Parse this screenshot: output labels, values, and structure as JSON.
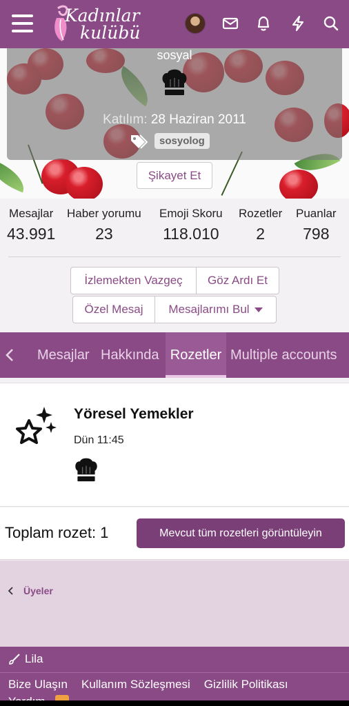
{
  "header": {
    "logo_line1": "Kadınlar",
    "logo_line2": "kulübü",
    "icons": [
      "menu-icon",
      "avatar",
      "envelope-icon",
      "bell-icon",
      "bolt-icon",
      "search-icon"
    ]
  },
  "cover": {
    "title": "sosyal",
    "joined_label": "Katılım:",
    "joined_date": "28 Haziran 2011",
    "tag": "sosyolog",
    "report_button": "Şikayet Et"
  },
  "stats": [
    {
      "label": "Mesajlar",
      "value": "43.991"
    },
    {
      "label": "Haber yorumu",
      "value": "23"
    },
    {
      "label": "Emoji Skoru",
      "value": "118.010"
    },
    {
      "label": "Rozetler",
      "value": "2"
    },
    {
      "label": "Puanlar",
      "value": "798"
    }
  ],
  "actions": {
    "unwatch": "İzlemekten Vazgeç",
    "ignore": "Göz Ardı Et",
    "private_message": "Özel Mesaj",
    "find_messages": "Mesajlarımı Bul"
  },
  "tabs": [
    {
      "label": "Mesajlar",
      "active": false
    },
    {
      "label": "Hakkında",
      "active": false
    },
    {
      "label": "Rozetler",
      "active": true
    },
    {
      "label": "Multiple accounts",
      "active": false
    }
  ],
  "badge": {
    "title": "Yöresel Yemekler",
    "time": "Dün 11:45"
  },
  "summary": {
    "total": "Toplam rozet: 1",
    "view_all": "Mevcut tüm rozetleri görüntüleyin"
  },
  "breadcrumb": "Üyeler",
  "footer": {
    "style": "Lila",
    "links": [
      "Bize Ulaşın",
      "Kullanım Sözleşmesi",
      "Gizlilik Politikası"
    ],
    "help": "Yardım"
  },
  "colors": {
    "brand": "#8a4a86",
    "brand_dark": "#7b3f78",
    "crumb_bg": "#e3d3e1"
  }
}
